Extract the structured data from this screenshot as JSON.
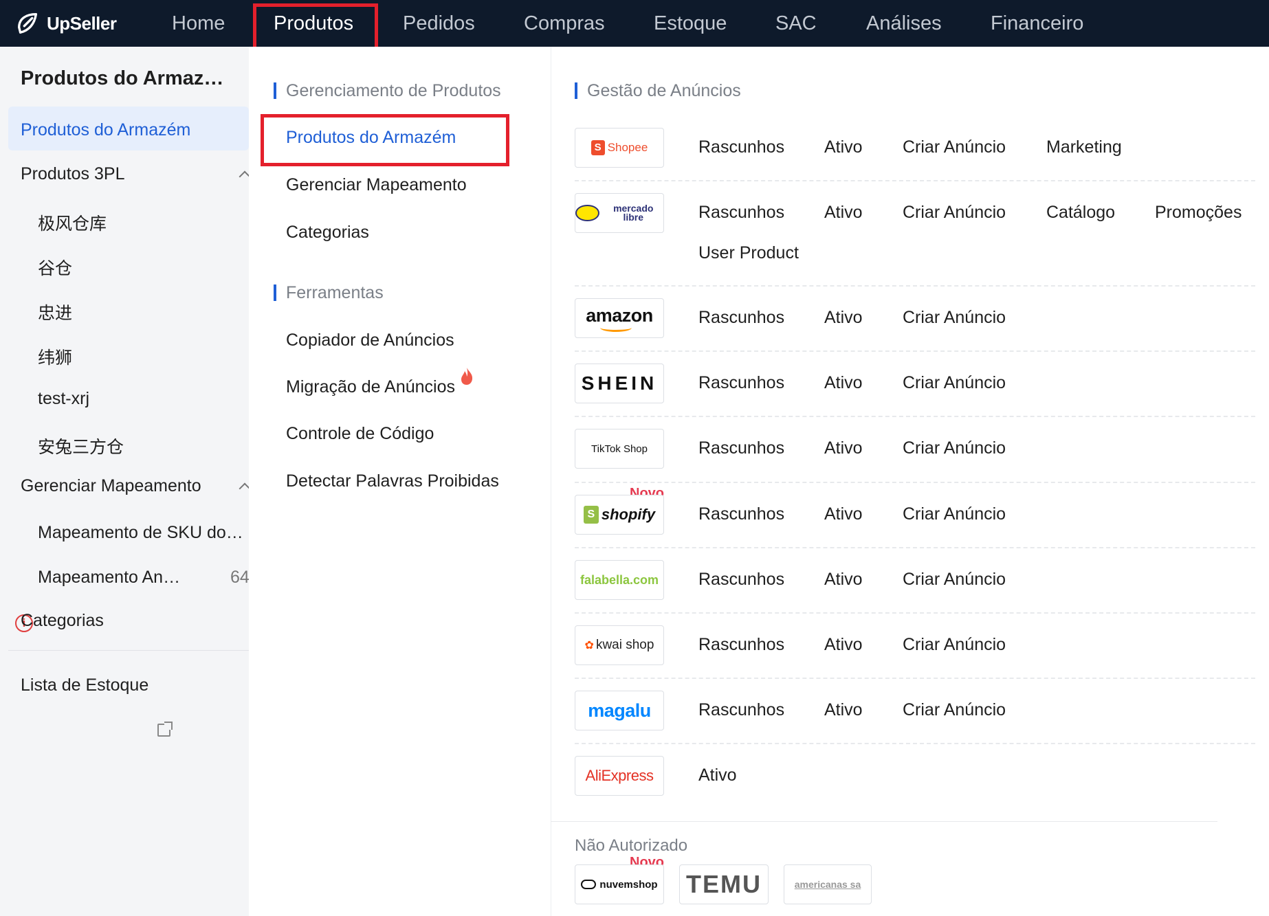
{
  "topbar": {
    "brand": "UpSeller",
    "nav": [
      {
        "label": "Home",
        "active": false
      },
      {
        "label": "Produtos",
        "active": true
      },
      {
        "label": "Pedidos",
        "active": false
      },
      {
        "label": "Compras",
        "active": false
      },
      {
        "label": "Estoque",
        "active": false
      },
      {
        "label": "SAC",
        "active": false
      },
      {
        "label": "Análises",
        "active": false
      },
      {
        "label": "Financeiro",
        "active": false
      }
    ]
  },
  "sidebar": {
    "title": "Produtos do Armazém",
    "items": [
      {
        "label": "Produtos do Armazém",
        "active": true
      },
      {
        "label": "Produtos 3PL",
        "expanded": true
      },
      {
        "label": "极风仓库"
      },
      {
        "label": "谷仓"
      },
      {
        "label": "忠进"
      },
      {
        "label": "纬狮"
      },
      {
        "label": "test-xrj"
      },
      {
        "label": "安兔三方仓"
      },
      {
        "label": "Gerenciar Mapeamento",
        "expanded": true
      },
      {
        "label": "Mapeamento de SKU do Anúncio"
      },
      {
        "label": "Mapeamento Anormal",
        "count": "64"
      },
      {
        "label": "Categorias"
      },
      {
        "label": "Lista de Estoque"
      }
    ]
  },
  "menu": {
    "section1_title": "Gerenciamento de Produtos",
    "section1_items": [
      "Produtos do Armazém",
      "Gerenciar Mapeamento",
      "Categorias"
    ],
    "section2_title": "Ferramentas",
    "section2_items": [
      "Copiador de Anúncios",
      "Migração de Anúncios",
      "Controle de Código",
      "Detectar Palavras Proibidas"
    ]
  },
  "listings": {
    "title": "Gestão de Anúncios",
    "marketplaces": [
      {
        "name": "Shopee",
        "links": [
          "Rascunhos",
          "Ativo",
          "Criar Anúncio",
          "Marketing"
        ]
      },
      {
        "name": "mercado libre",
        "links": [
          "Rascunhos",
          "Ativo",
          "Criar Anúncio",
          "Catálogo",
          "Promoções",
          "User Product"
        ]
      },
      {
        "name": "amazon",
        "links": [
          "Rascunhos",
          "Ativo",
          "Criar Anúncio"
        ]
      },
      {
        "name": "SHEIN",
        "links": [
          "Rascunhos",
          "Ativo",
          "Criar Anúncio"
        ]
      },
      {
        "name": "TikTok Shop",
        "links": [
          "Rascunhos",
          "Ativo",
          "Criar Anúncio"
        ]
      },
      {
        "name": "shopify",
        "badge": "Novo",
        "links": [
          "Rascunhos",
          "Ativo",
          "Criar Anúncio"
        ]
      },
      {
        "name": "falabella.com",
        "links": [
          "Rascunhos",
          "Ativo",
          "Criar Anúncio"
        ]
      },
      {
        "name": "kwai shop",
        "links": [
          "Rascunhos",
          "Ativo",
          "Criar Anúncio"
        ]
      },
      {
        "name": "magalu",
        "links": [
          "Rascunhos",
          "Ativo",
          "Criar Anúncio"
        ]
      },
      {
        "name": "AliExpress",
        "links": [
          "Ativo"
        ]
      }
    ],
    "unauthorized_title": "Não Autorizado",
    "unauthorized": [
      {
        "name": "nuvemshop",
        "badge": "Novo"
      },
      {
        "name": "TEMU"
      },
      {
        "name": "americanas sa"
      }
    ]
  },
  "colors": {
    "topbar": "#0e1a2b",
    "accent": "#1f5fd6",
    "highlight": "#e4202c",
    "badge": "#e53a50"
  }
}
